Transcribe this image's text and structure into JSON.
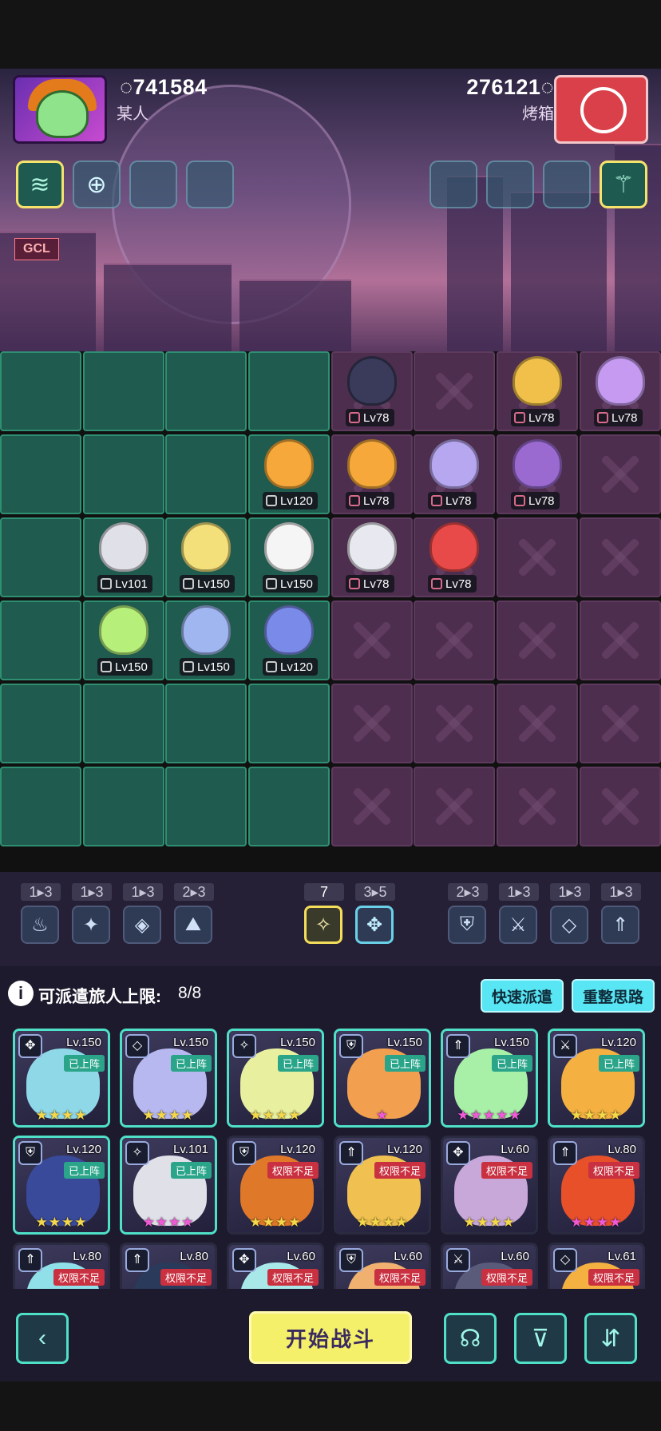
{
  "players": {
    "left": {
      "score": "741584",
      "name": "某人"
    },
    "right": {
      "score": "276121",
      "name": "烤箱"
    }
  },
  "header": {
    "sign_text": "GCL"
  },
  "synergy": {
    "left_groups": [
      {
        "count": "1▸3",
        "icon": "flame-icon",
        "glyph": "♨"
      },
      {
        "count": "1▸3",
        "icon": "shuriken-icon",
        "glyph": "✦"
      },
      {
        "count": "1▸3",
        "icon": "crystal-icon",
        "glyph": "◈"
      },
      {
        "count": "2▸3",
        "icon": "mountain-icon",
        "glyph": "⛰"
      }
    ],
    "center_groups": [
      {
        "count": "7",
        "icon": "star-burst-icon",
        "glyph": "✧",
        "style": "gold"
      },
      {
        "count": "3▸5",
        "icon": "compass-icon",
        "glyph": "✥",
        "style": "blue"
      }
    ],
    "right_groups": [
      {
        "count": "2▸3",
        "icon": "shield-icon",
        "glyph": "⛨"
      },
      {
        "count": "1▸3",
        "icon": "crossed-swords-icon",
        "glyph": "⚔"
      },
      {
        "count": "1▸3",
        "icon": "diamond-icon",
        "glyph": "◇"
      },
      {
        "count": "1▸3",
        "icon": "arrow-up-icon",
        "glyph": "⇑"
      }
    ]
  },
  "roster_header": {
    "label": "可派遣旅人上限:",
    "count": "8/8",
    "info_glyph": "i",
    "quick_deploy": "快速派遣",
    "reset": "重整思路"
  },
  "allies": [
    {
      "level": "Lv120",
      "color": "#f6a93a"
    },
    {
      "level": "Lv101",
      "color": "#e0e0e8"
    },
    {
      "level": "Lv150",
      "color": "#f3e07a"
    },
    {
      "level": "Lv150",
      "color": "#f5f5f5"
    },
    {
      "level": "Lv150",
      "color": "#b6f07a"
    },
    {
      "level": "Lv150",
      "color": "#9fb6f0"
    },
    {
      "level": "Lv120",
      "color": "#7a8ae8"
    }
  ],
  "enemies": [
    {
      "level": "Lv78",
      "color": "#3a3a5a"
    },
    {
      "level": "Lv78",
      "color": "#f0c04a"
    },
    {
      "level": "Lv78",
      "color": "#c59af0"
    },
    {
      "level": "Lv78",
      "color": "#f6a93a"
    },
    {
      "level": "Lv78",
      "color": "#b7a6f0"
    },
    {
      "level": "Lv78",
      "color": "#9a6ad0"
    },
    {
      "level": "Lv78",
      "color": "#e8e8f0"
    },
    {
      "level": "Lv78",
      "color": "#e84a4a"
    }
  ],
  "cards": [
    {
      "level": "Lv.150",
      "status": "已上阵",
      "state": "on",
      "stars": "★★★★",
      "pink": false,
      "cls": "✥",
      "color": "#8fd8e8"
    },
    {
      "level": "Lv.150",
      "status": "已上阵",
      "state": "on",
      "stars": "★★★★",
      "pink": false,
      "cls": "◇",
      "color": "#b8b8f0"
    },
    {
      "level": "Lv.150",
      "status": "已上阵",
      "state": "on",
      "stars": "★★★★",
      "pink": false,
      "cls": "✧",
      "color": "#e8f0a0"
    },
    {
      "level": "Lv.150",
      "status": "已上阵",
      "state": "on",
      "stars": "★",
      "pink": true,
      "cls": "⛨",
      "color": "#f2a050"
    },
    {
      "level": "Lv.150",
      "status": "已上阵",
      "state": "on",
      "stars": "★★★★★",
      "pink": true,
      "cls": "⇑",
      "color": "#a8f0a8"
    },
    {
      "level": "Lv.120",
      "status": "已上阵",
      "state": "on",
      "stars": "★★★★",
      "pink": false,
      "cls": "⚔",
      "color": "#f4b040"
    },
    {
      "level": "Lv.120",
      "status": "已上阵",
      "state": "on",
      "stars": "★★★★",
      "pink": false,
      "cls": "⛨",
      "color": "#3a4a9a"
    },
    {
      "level": "Lv.101",
      "status": "已上阵",
      "state": "on",
      "stars": "★★★★",
      "pink": true,
      "cls": "✧",
      "color": "#e0e0e8"
    },
    {
      "level": "Lv.120",
      "status": "权限不足",
      "state": "no",
      "stars": "★★★★",
      "pink": false,
      "cls": "⛨",
      "color": "#e0782a"
    },
    {
      "level": "Lv.120",
      "status": "权限不足",
      "state": "no",
      "stars": "★★★★",
      "pink": false,
      "cls": "⇑",
      "color": "#f0c050"
    },
    {
      "level": "Lv.60",
      "status": "权限不足",
      "state": "no",
      "stars": "★★★★",
      "pink": false,
      "cls": "✥",
      "color": "#c8a8d8"
    },
    {
      "level": "Lv.80",
      "status": "权限不足",
      "state": "no",
      "stars": "★★★★",
      "pink": true,
      "cls": "⇑",
      "color": "#e8502a"
    },
    {
      "level": "Lv.80",
      "status": "权限不足",
      "state": "no",
      "stars": "",
      "pink": false,
      "cls": "⇑",
      "color": "#8fe0e8"
    },
    {
      "level": "Lv.80",
      "status": "权限不足",
      "state": "no",
      "stars": "",
      "pink": false,
      "cls": "⇑",
      "color": "#2a3a5a"
    },
    {
      "level": "Lv.60",
      "status": "权限不足",
      "state": "no",
      "stars": "",
      "pink": false,
      "cls": "✥",
      "color": "#a8e8e8"
    },
    {
      "level": "Lv.60",
      "status": "权限不足",
      "state": "no",
      "stars": "",
      "pink": false,
      "cls": "⛨",
      "color": "#f0b070"
    },
    {
      "level": "Lv.60",
      "status": "权限不足",
      "state": "no",
      "stars": "",
      "pink": false,
      "cls": "⚔",
      "color": "#5a5a7a"
    },
    {
      "level": "Lv.61",
      "status": "权限不足",
      "state": "no",
      "stars": "",
      "pink": false,
      "cls": "◇",
      "color": "#f4b040"
    }
  ],
  "footer": {
    "back_glyph": "‹",
    "start": "开始战斗",
    "brain_glyph": "☊",
    "filter_glyph": "⊽",
    "sort_glyph": "⇵"
  },
  "colors": {
    "accent_cyan": "#58e6f4",
    "accent_yellow": "#f4f06a",
    "ally_tile": "#1f5b4e",
    "enemy_tile": "#4e2e4e"
  }
}
